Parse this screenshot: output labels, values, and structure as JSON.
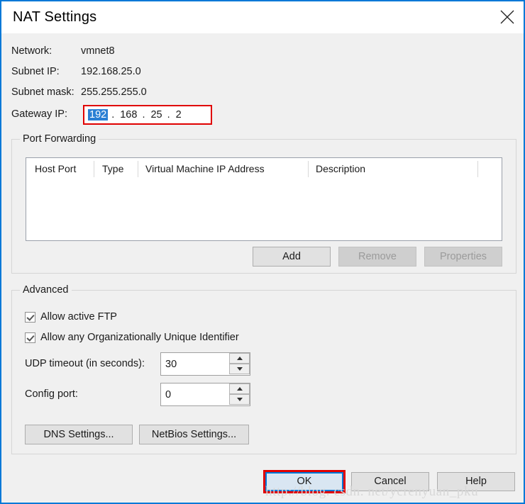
{
  "window": {
    "title": "NAT Settings",
    "close_icon": "close-icon",
    "accent_color": "#0078d7",
    "annotation_color": "#e00000",
    "background_color": "#f0f0f0"
  },
  "info": {
    "rows": [
      {
        "label": "Network:",
        "value": "vmnet8"
      },
      {
        "label": "Subnet IP:",
        "value": "192.168.25.0"
      },
      {
        "label": "Subnet mask:",
        "value": "255.255.255.0"
      }
    ],
    "gateway": {
      "label": "Gateway IP:",
      "octets": [
        "192",
        "168",
        "25",
        "2"
      ],
      "selected_index": 0,
      "separator": "."
    }
  },
  "port_forwarding": {
    "legend": "Port Forwarding",
    "columns": [
      "Host Port",
      "Type",
      "Virtual Machine IP Address",
      "Description"
    ],
    "rows": [],
    "buttons": [
      {
        "label": "Add",
        "enabled": true
      },
      {
        "label": "Remove",
        "enabled": false
      },
      {
        "label": "Properties",
        "enabled": false
      }
    ]
  },
  "advanced": {
    "legend": "Advanced",
    "checkboxes": [
      {
        "label": "Allow active FTP",
        "checked": true
      },
      {
        "label": "Allow any Organizationally Unique Identifier",
        "checked": true
      }
    ],
    "fields": [
      {
        "label": "UDP timeout (in seconds):",
        "value": "30"
      },
      {
        "label": "Config port:",
        "value": "0"
      }
    ],
    "buttons": [
      {
        "label": "DNS Settings..."
      },
      {
        "label": "NetBios Settings..."
      }
    ]
  },
  "footer": {
    "buttons": [
      {
        "label": "OK",
        "focused": true,
        "annotated": true
      },
      {
        "label": "Cancel",
        "focused": false,
        "annotated": false
      },
      {
        "label": "Help",
        "focused": false,
        "annotated": false
      }
    ]
  },
  "watermark": "http://blog. csdn. net/ycrenyuan_pku"
}
